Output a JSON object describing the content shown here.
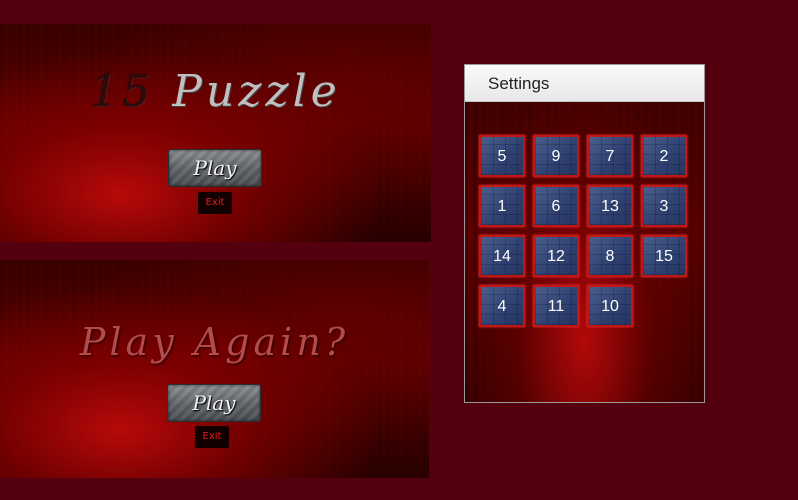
{
  "menu": {
    "title_part1": "15 ",
    "title_part2": "Puzzle",
    "play_label": "Play",
    "exit_label": "Exit"
  },
  "again": {
    "title": "Play Again?",
    "play_label": "Play",
    "exit_label": "Exit"
  },
  "settings": {
    "window_title": "Settings",
    "tiles": [
      [
        "5",
        "9",
        "7",
        "2"
      ],
      [
        "1",
        "6",
        "13",
        "3"
      ],
      [
        "14",
        "12",
        "8",
        "15"
      ],
      [
        "4",
        "11",
        "10",
        ""
      ]
    ]
  },
  "colors": {
    "background": "#55000f",
    "tile_border": "#c31616",
    "exit_text": "#e31c1c"
  }
}
